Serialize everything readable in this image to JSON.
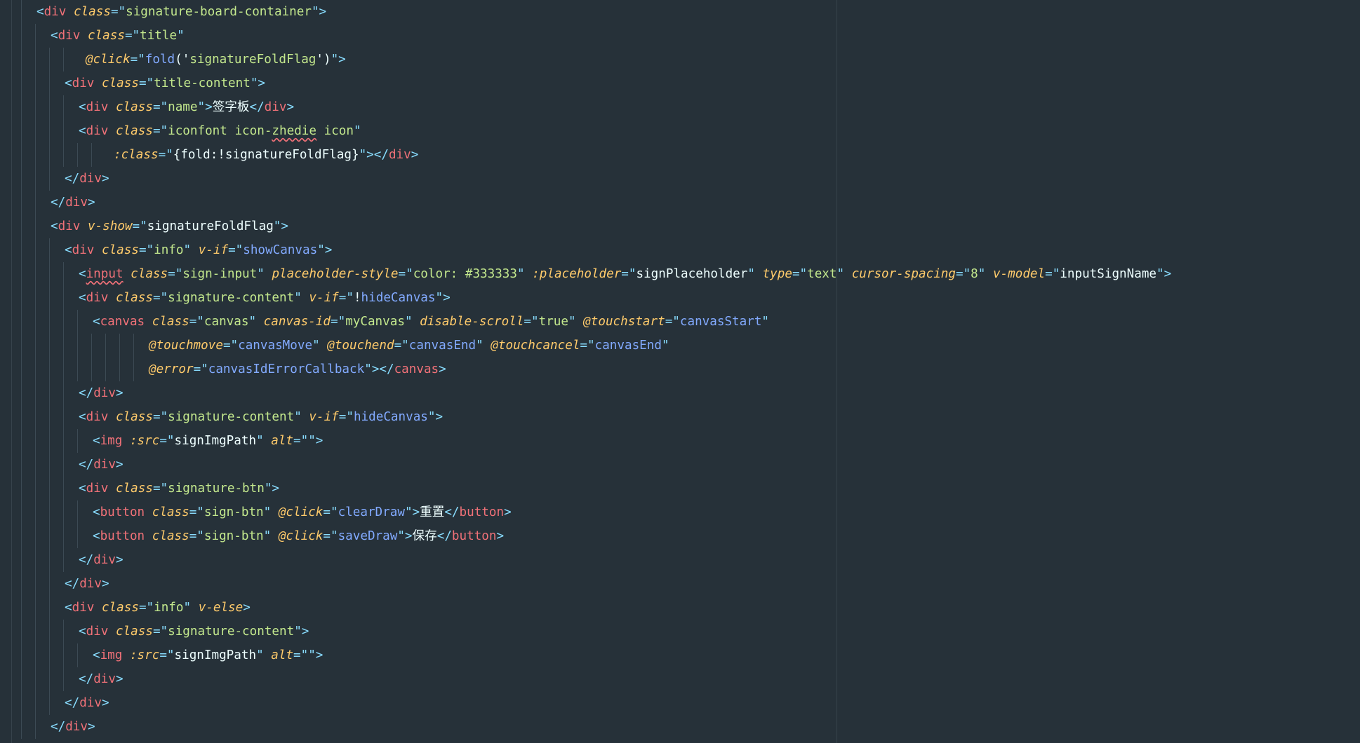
{
  "editor": {
    "colors": {
      "background": "#263139",
      "punctuation": "#89ddff",
      "tag": "#f07178",
      "attribute": "#ffcb6b",
      "string": "#c3e88d",
      "function": "#82aaff",
      "text": "#eeffff"
    },
    "lines": [
      {
        "indent": 0,
        "tokens": [
          [
            "p",
            "<"
          ],
          [
            "t",
            "div"
          ],
          [
            "v",
            " "
          ],
          [
            "a",
            "class"
          ],
          [
            "p",
            "=\""
          ],
          [
            "s",
            "signature-board-container"
          ],
          [
            "p",
            "\">"
          ]
        ]
      },
      {
        "indent": 1,
        "tokens": [
          [
            "p",
            "<"
          ],
          [
            "t",
            "div"
          ],
          [
            "v",
            " "
          ],
          [
            "a",
            "class"
          ],
          [
            "p",
            "=\""
          ],
          [
            "s",
            "title"
          ],
          [
            "p",
            "\""
          ]
        ]
      },
      {
        "indent": 3.5,
        "tokens": [
          [
            "a",
            "@click"
          ],
          [
            "p",
            "=\""
          ],
          [
            "f",
            "fold"
          ],
          [
            "v",
            "('"
          ],
          [
            "s",
            "signatureFoldFlag"
          ],
          [
            "v",
            "')"
          ],
          [
            "p",
            "\">"
          ]
        ]
      },
      {
        "indent": 2,
        "tokens": [
          [
            "p",
            "<"
          ],
          [
            "t",
            "div"
          ],
          [
            "v",
            " "
          ],
          [
            "a",
            "class"
          ],
          [
            "p",
            "=\""
          ],
          [
            "s",
            "title-content"
          ],
          [
            "p",
            "\">"
          ]
        ]
      },
      {
        "indent": 3,
        "tokens": [
          [
            "p",
            "<"
          ],
          [
            "t",
            "div"
          ],
          [
            "v",
            " "
          ],
          [
            "a",
            "class"
          ],
          [
            "p",
            "=\""
          ],
          [
            "s",
            "name"
          ],
          [
            "p",
            "\">"
          ],
          [
            "txt",
            "签字板"
          ],
          [
            "p",
            "</"
          ],
          [
            "t",
            "div"
          ],
          [
            "p",
            ">"
          ]
        ]
      },
      {
        "indent": 3,
        "tokens": [
          [
            "p",
            "<"
          ],
          [
            "t",
            "div"
          ],
          [
            "v",
            " "
          ],
          [
            "a",
            "class"
          ],
          [
            "p",
            "=\""
          ],
          [
            "s",
            "iconfont icon-"
          ],
          [
            "sq",
            "zhedie"
          ],
          [
            "s",
            " icon"
          ],
          [
            "p",
            "\""
          ]
        ]
      },
      {
        "indent": 5.5,
        "tokens": [
          [
            "a",
            ":class"
          ],
          [
            "p",
            "=\""
          ],
          [
            "v",
            "{fold:!signatureFoldFlag}"
          ],
          [
            "p",
            "\">"
          ],
          [
            "p",
            "</"
          ],
          [
            "t",
            "div"
          ],
          [
            "p",
            ">"
          ]
        ]
      },
      {
        "indent": 2,
        "tokens": [
          [
            "p",
            "</"
          ],
          [
            "t",
            "div"
          ],
          [
            "p",
            ">"
          ]
        ]
      },
      {
        "indent": 1,
        "tokens": [
          [
            "p",
            "</"
          ],
          [
            "t",
            "div"
          ],
          [
            "p",
            ">"
          ]
        ]
      },
      {
        "indent": 1,
        "tokens": [
          [
            "p",
            "<"
          ],
          [
            "t",
            "div"
          ],
          [
            "v",
            " "
          ],
          [
            "a",
            "v-show"
          ],
          [
            "p",
            "=\""
          ],
          [
            "v",
            "signatureFoldFlag"
          ],
          [
            "p",
            "\">"
          ]
        ]
      },
      {
        "indent": 2,
        "tokens": [
          [
            "p",
            "<"
          ],
          [
            "t",
            "div"
          ],
          [
            "v",
            " "
          ],
          [
            "a",
            "class"
          ],
          [
            "p",
            "=\""
          ],
          [
            "s",
            "info"
          ],
          [
            "p",
            "\""
          ],
          [
            "v",
            " "
          ],
          [
            "a",
            "v-if"
          ],
          [
            "p",
            "=\""
          ],
          [
            "f",
            "showCanvas"
          ],
          [
            "p",
            "\">"
          ]
        ]
      },
      {
        "indent": 3,
        "tokens": [
          [
            "p",
            "<"
          ],
          [
            "tsq",
            "input"
          ],
          [
            "v",
            " "
          ],
          [
            "a",
            "class"
          ],
          [
            "p",
            "=\""
          ],
          [
            "s",
            "sign-input"
          ],
          [
            "p",
            "\""
          ],
          [
            "v",
            " "
          ],
          [
            "a",
            "placeholder-style"
          ],
          [
            "p",
            "=\""
          ],
          [
            "s",
            "color: #333333"
          ],
          [
            "p",
            "\""
          ],
          [
            "v",
            " "
          ],
          [
            "a",
            ":placeholder"
          ],
          [
            "p",
            "=\""
          ],
          [
            "v",
            "signPlaceholder"
          ],
          [
            "p",
            "\""
          ],
          [
            "v",
            " "
          ],
          [
            "a",
            "type"
          ],
          [
            "p",
            "=\""
          ],
          [
            "s",
            "text"
          ],
          [
            "p",
            "\""
          ],
          [
            "v",
            " "
          ],
          [
            "a",
            "cursor-spacing"
          ],
          [
            "p",
            "=\""
          ],
          [
            "s",
            "8"
          ],
          [
            "p",
            "\""
          ],
          [
            "v",
            " "
          ],
          [
            "a",
            "v-model"
          ],
          [
            "p",
            "=\""
          ],
          [
            "v",
            "inputSignName"
          ],
          [
            "p",
            "\">"
          ]
        ]
      },
      {
        "indent": 3,
        "tokens": [
          [
            "p",
            "<"
          ],
          [
            "t",
            "div"
          ],
          [
            "v",
            " "
          ],
          [
            "a",
            "class"
          ],
          [
            "p",
            "=\""
          ],
          [
            "s",
            "signature-content"
          ],
          [
            "p",
            "\""
          ],
          [
            "v",
            " "
          ],
          [
            "a",
            "v-if"
          ],
          [
            "p",
            "=\""
          ],
          [
            "v",
            "!"
          ],
          [
            "f",
            "hideCanvas"
          ],
          [
            "p",
            "\">"
          ]
        ]
      },
      {
        "indent": 4,
        "tokens": [
          [
            "p",
            "<"
          ],
          [
            "t",
            "canvas"
          ],
          [
            "v",
            " "
          ],
          [
            "a",
            "class"
          ],
          [
            "p",
            "=\""
          ],
          [
            "s",
            "canvas"
          ],
          [
            "p",
            "\""
          ],
          [
            "v",
            " "
          ],
          [
            "a",
            "canvas-id"
          ],
          [
            "p",
            "=\""
          ],
          [
            "s",
            "myCanvas"
          ],
          [
            "p",
            "\""
          ],
          [
            "v",
            " "
          ],
          [
            "a",
            "disable-scroll"
          ],
          [
            "p",
            "=\""
          ],
          [
            "s",
            "true"
          ],
          [
            "p",
            "\""
          ],
          [
            "v",
            " "
          ],
          [
            "a",
            "@touchstart"
          ],
          [
            "p",
            "=\""
          ],
          [
            "f",
            "canvasStart"
          ],
          [
            "p",
            "\""
          ]
        ]
      },
      {
        "indent": 8,
        "tokens": [
          [
            "a",
            "@touchmove"
          ],
          [
            "p",
            "=\""
          ],
          [
            "f",
            "canvasMove"
          ],
          [
            "p",
            "\""
          ],
          [
            "v",
            " "
          ],
          [
            "a",
            "@touchend"
          ],
          [
            "p",
            "=\""
          ],
          [
            "f",
            "canvasEnd"
          ],
          [
            "p",
            "\""
          ],
          [
            "v",
            " "
          ],
          [
            "a",
            "@touchcancel"
          ],
          [
            "p",
            "=\""
          ],
          [
            "f",
            "canvasEnd"
          ],
          [
            "p",
            "\""
          ]
        ]
      },
      {
        "indent": 8,
        "tokens": [
          [
            "a",
            "@error"
          ],
          [
            "p",
            "=\""
          ],
          [
            "f",
            "canvasIdErrorCallback"
          ],
          [
            "p",
            "\">"
          ],
          [
            "p",
            "</"
          ],
          [
            "t",
            "canvas"
          ],
          [
            "p",
            ">"
          ]
        ]
      },
      {
        "indent": 3,
        "tokens": [
          [
            "p",
            "</"
          ],
          [
            "t",
            "div"
          ],
          [
            "p",
            ">"
          ]
        ]
      },
      {
        "indent": 3,
        "tokens": [
          [
            "p",
            "<"
          ],
          [
            "t",
            "div"
          ],
          [
            "v",
            " "
          ],
          [
            "a",
            "class"
          ],
          [
            "p",
            "=\""
          ],
          [
            "s",
            "signature-content"
          ],
          [
            "p",
            "\""
          ],
          [
            "v",
            " "
          ],
          [
            "a",
            "v-if"
          ],
          [
            "p",
            "=\""
          ],
          [
            "f",
            "hideCanvas"
          ],
          [
            "p",
            "\">"
          ]
        ]
      },
      {
        "indent": 4,
        "tokens": [
          [
            "p",
            "<"
          ],
          [
            "t",
            "img"
          ],
          [
            "v",
            " "
          ],
          [
            "a",
            ":src"
          ],
          [
            "p",
            "=\""
          ],
          [
            "v",
            "signImgPath"
          ],
          [
            "p",
            "\""
          ],
          [
            "v",
            " "
          ],
          [
            "a",
            "alt"
          ],
          [
            "p",
            "=\"\">"
          ]
        ]
      },
      {
        "indent": 3,
        "tokens": [
          [
            "p",
            "</"
          ],
          [
            "t",
            "div"
          ],
          [
            "p",
            ">"
          ]
        ]
      },
      {
        "indent": 3,
        "tokens": [
          [
            "p",
            "<"
          ],
          [
            "t",
            "div"
          ],
          [
            "v",
            " "
          ],
          [
            "a",
            "class"
          ],
          [
            "p",
            "=\""
          ],
          [
            "s",
            "signature-btn"
          ],
          [
            "p",
            "\">"
          ]
        ]
      },
      {
        "indent": 4,
        "tokens": [
          [
            "p",
            "<"
          ],
          [
            "t",
            "button"
          ],
          [
            "v",
            " "
          ],
          [
            "a",
            "class"
          ],
          [
            "p",
            "=\""
          ],
          [
            "s",
            "sign-btn"
          ],
          [
            "p",
            "\""
          ],
          [
            "v",
            " "
          ],
          [
            "a",
            "@click"
          ],
          [
            "p",
            "=\""
          ],
          [
            "f",
            "clearDraw"
          ],
          [
            "p",
            "\">"
          ],
          [
            "txt",
            "重置"
          ],
          [
            "p",
            "</"
          ],
          [
            "t",
            "button"
          ],
          [
            "p",
            ">"
          ]
        ]
      },
      {
        "indent": 4,
        "tokens": [
          [
            "p",
            "<"
          ],
          [
            "t",
            "button"
          ],
          [
            "v",
            " "
          ],
          [
            "a",
            "class"
          ],
          [
            "p",
            "=\""
          ],
          [
            "s",
            "sign-btn"
          ],
          [
            "p",
            "\""
          ],
          [
            "v",
            " "
          ],
          [
            "a",
            "@click"
          ],
          [
            "p",
            "=\""
          ],
          [
            "f",
            "saveDraw"
          ],
          [
            "p",
            "\">"
          ],
          [
            "txt",
            "保存"
          ],
          [
            "p",
            "</"
          ],
          [
            "t",
            "button"
          ],
          [
            "p",
            ">"
          ]
        ]
      },
      {
        "indent": 3,
        "tokens": [
          [
            "p",
            "</"
          ],
          [
            "t",
            "div"
          ],
          [
            "p",
            ">"
          ]
        ]
      },
      {
        "indent": 2,
        "tokens": [
          [
            "p",
            "</"
          ],
          [
            "t",
            "div"
          ],
          [
            "p",
            ">"
          ]
        ]
      },
      {
        "indent": 2,
        "tokens": [
          [
            "p",
            "<"
          ],
          [
            "t",
            "div"
          ],
          [
            "v",
            " "
          ],
          [
            "a",
            "class"
          ],
          [
            "p",
            "=\""
          ],
          [
            "s",
            "info"
          ],
          [
            "p",
            "\""
          ],
          [
            "v",
            " "
          ],
          [
            "a",
            "v-else"
          ],
          [
            "p",
            ">"
          ]
        ]
      },
      {
        "indent": 3,
        "tokens": [
          [
            "p",
            "<"
          ],
          [
            "t",
            "div"
          ],
          [
            "v",
            " "
          ],
          [
            "a",
            "class"
          ],
          [
            "p",
            "=\""
          ],
          [
            "s",
            "signature-content"
          ],
          [
            "p",
            "\">"
          ]
        ]
      },
      {
        "indent": 4,
        "tokens": [
          [
            "p",
            "<"
          ],
          [
            "t",
            "img"
          ],
          [
            "v",
            " "
          ],
          [
            "a",
            ":src"
          ],
          [
            "p",
            "=\""
          ],
          [
            "v",
            "signImgPath"
          ],
          [
            "p",
            "\""
          ],
          [
            "v",
            " "
          ],
          [
            "a",
            "alt"
          ],
          [
            "p",
            "=\"\">"
          ]
        ]
      },
      {
        "indent": 3,
        "tokens": [
          [
            "p",
            "</"
          ],
          [
            "t",
            "div"
          ],
          [
            "p",
            ">"
          ]
        ]
      },
      {
        "indent": 2,
        "tokens": [
          [
            "p",
            "</"
          ],
          [
            "t",
            "div"
          ],
          [
            "p",
            ">"
          ]
        ]
      },
      {
        "indent": 1,
        "tokens": [
          [
            "p",
            "</"
          ],
          [
            "t",
            "div"
          ],
          [
            "p",
            ">"
          ]
        ]
      }
    ]
  }
}
